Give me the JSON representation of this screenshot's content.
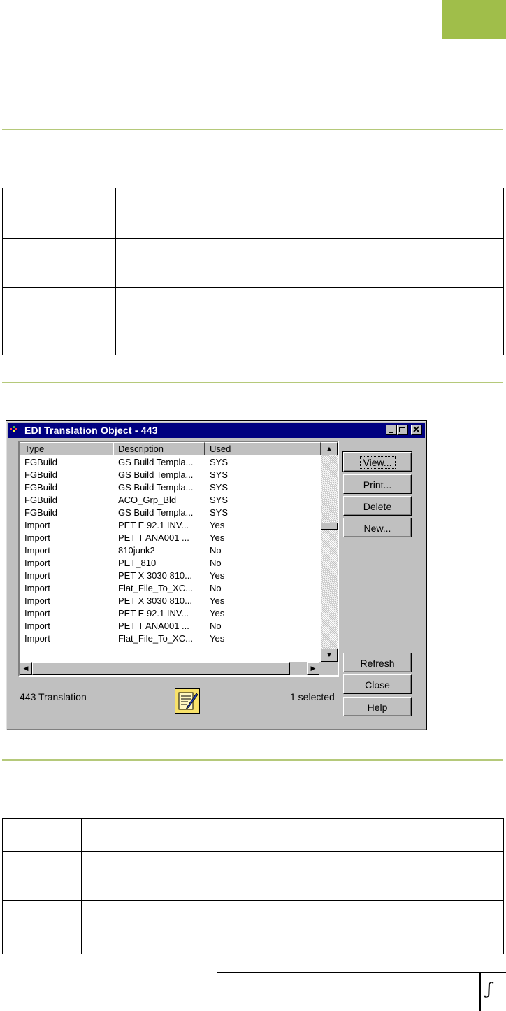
{
  "window": {
    "title": "EDI Translation Object - 443",
    "controls": {
      "minimize_icon": "minimize-icon",
      "maximize_icon": "maximize-icon",
      "close_icon": "close-icon"
    }
  },
  "list": {
    "columns": [
      "Type",
      "Description",
      "Used"
    ],
    "rows": [
      {
        "type": "FGBuild",
        "description": "GS Build Templa...",
        "used": "SYS"
      },
      {
        "type": "FGBuild",
        "description": "GS Build Templa...",
        "used": "SYS"
      },
      {
        "type": "FGBuild",
        "description": "GS Build Templa...",
        "used": "SYS"
      },
      {
        "type": "FGBuild",
        "description": "ACO_Grp_Bld",
        "used": "SYS"
      },
      {
        "type": "FGBuild",
        "description": "GS Build Templa...",
        "used": "SYS"
      },
      {
        "type": "Import",
        "description": "PET E 92.1 INV...",
        "used": "Yes"
      },
      {
        "type": "Import",
        "description": "PET T ANA001 ...",
        "used": "Yes"
      },
      {
        "type": "Import",
        "description": "810junk2",
        "used": "No"
      },
      {
        "type": "Import",
        "description": "PET_810",
        "used": "No"
      },
      {
        "type": "Import",
        "description": "PET X 3030 810...",
        "used": "Yes"
      },
      {
        "type": "Import",
        "description": "Flat_File_To_XC...",
        "used": "No"
      },
      {
        "type": "Import",
        "description": "PET X 3030 810...",
        "used": "Yes"
      },
      {
        "type": "Import",
        "description": "PET E 92.1 INV...",
        "used": "Yes"
      },
      {
        "type": "Import",
        "description": "PET T ANA001 ...",
        "used": "No"
      },
      {
        "type": "Import",
        "description": "Flat_File_To_XC...",
        "used": "Yes"
      }
    ],
    "scroll_position": 0.36
  },
  "buttons": {
    "view": "View...",
    "print": "Print...",
    "delete": "Delete",
    "new": "New...",
    "refresh": "Refresh",
    "close": "Close",
    "help": "Help"
  },
  "status": {
    "left": "443 Translation",
    "right": "1 selected",
    "icon": "translation-document-icon"
  },
  "page": {
    "number": "ʃ",
    "accent_color": "#a0be4a"
  }
}
